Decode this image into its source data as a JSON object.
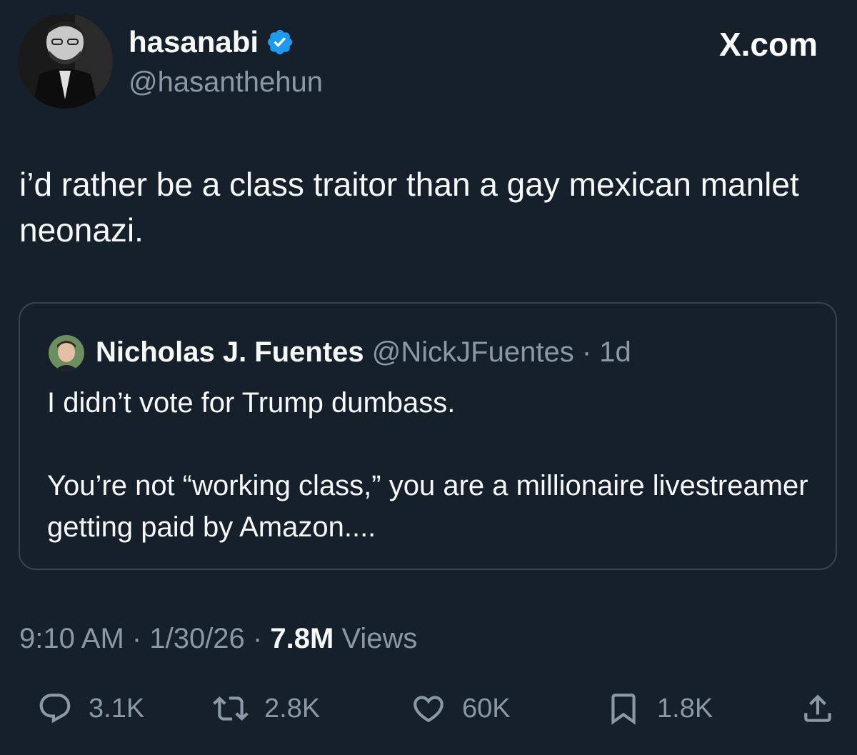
{
  "author": {
    "display_name": "hasanabi",
    "handle": "@hasanthehun"
  },
  "brand": {
    "label": "X.com"
  },
  "tweet": {
    "text": "i’d rather be a class traitor than a gay mexican manlet neonazi."
  },
  "quoted": {
    "display_name": "Nicholas J. Fuentes",
    "handle": "@NickJFuentes",
    "separator": "·",
    "age": "1d",
    "line1": "I didn’t vote for Trump dumbass.",
    "line2": "You’re not “working class,” you are a millionaire livestreamer getting paid by Amazon...."
  },
  "meta": {
    "time": "9:10 AM",
    "separator": "·",
    "date": "1/30/26",
    "views_count": "7.8M",
    "views_label": "Views"
  },
  "actions": {
    "replies": "3.1K",
    "reposts": "2.8K",
    "likes": "60K",
    "bookmarks": "1.8K"
  },
  "icons": {
    "verified": "verified-badge-icon",
    "reply": "reply-icon",
    "repost": "repost-icon",
    "like": "heart-icon",
    "bookmark": "bookmark-icon",
    "share": "share-icon"
  },
  "colors": {
    "background": "#15202b",
    "text": "#f7f9f9",
    "secondary": "#8b98a5",
    "verified": "#1d9bf0",
    "border": "#38444d"
  }
}
